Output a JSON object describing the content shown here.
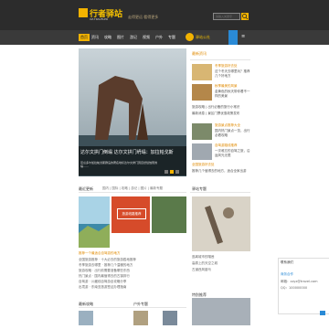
{
  "header": {
    "logo_text": "行者驿站",
    "logo_sub": "XZ-TRAVELER",
    "slogan": "走得更远·看得更多",
    "search_placeholder": "请输入关键字"
  },
  "nav": {
    "items": [
      {
        "label": "首页",
        "active": true
      },
      {
        "label": "资讯",
        "active": false
      },
      {
        "label": "攻略",
        "active": false
      },
      {
        "label": "图片",
        "active": false
      },
      {
        "label": "游记",
        "active": false
      },
      {
        "label": "视频",
        "active": false
      },
      {
        "label": "户外",
        "active": false
      },
      {
        "label": "专题",
        "active": false
      }
    ],
    "special_label": "驿站公社"
  },
  "hero": {
    "caption": "达尔文拱门倒塌 达尔文拱门坍塌：加拉帕戈斯",
    "desc": "厄瓜多尔加拉帕戈斯群岛的著名地标达尔文拱门因自然侵蚀而倒塌……",
    "slide_count": 6,
    "active_slide": 4
  },
  "latest": {
    "title": "最新资讯",
    "items": [
      {
        "title": "冬季旅游好去处",
        "desc": "这个冬天去哪里玩？推荐几个好地方"
      },
      {
        "title": "秋季最美的风景",
        "desc": "金黄色的秋天带你看不一样的美景"
      },
      {
        "title": "旅游景点推荐大全",
        "desc": "国内热门景点一览，出行必看攻略"
      },
      {
        "title": "自驾游路线推荐",
        "desc": "一次难忘的自驾之旅，沿途风光无限"
      },
      {
        "title": "全国旅游好去处",
        "desc": "推荐几个值得去的地方，适合全家出游"
      }
    ],
    "links": [
      "旅游攻略 | 出行必备的旅行小常识",
      "最新消息 | 景区门票优惠政策发布"
    ]
  },
  "section2": {
    "title": "最近更新",
    "tabs": "国内 | 国际 | 攻略 | 游记 | 图片 | 最新专题",
    "lines": [
      "全国旅游推荐 · 十大必去的旅游胜地推荐",
      "冬季旅游去哪里 · 推荐几个温暖的地方",
      "旅游攻略 · 出行前需要准备哪些东西",
      "热门景点 · 国内最值得去的古镇排行",
      "自驾游 · 川藏线自驾游全攻略分享",
      "出境游 · 东南亚旅游签证办理指南"
    ],
    "orange_line": "推荐一个最适合自驾游的地方",
    "badge": "旅游线路推荐"
  },
  "sidebar2": {
    "title": "驿站专题",
    "items": [
      "逃离城市的喧嚣",
      "高原上的天空之城",
      "古道西风瘦马"
    ]
  },
  "bottom": {
    "left_title": "最新攻略",
    "mid_title": "户外专题",
    "right_title": "特别推荐"
  },
  "float_panel": {
    "title": "联系我们",
    "line1": "商务合作",
    "line2": "邮箱：xzyz@travel.com",
    "line3": "QQ：100000000"
  },
  "colors": {
    "accent": "#f3b300",
    "header_bg": "#2c2c2c",
    "nav_bg": "#3a3a3a",
    "link_orange": "#e08a00",
    "blue": "#2a8ad6"
  }
}
